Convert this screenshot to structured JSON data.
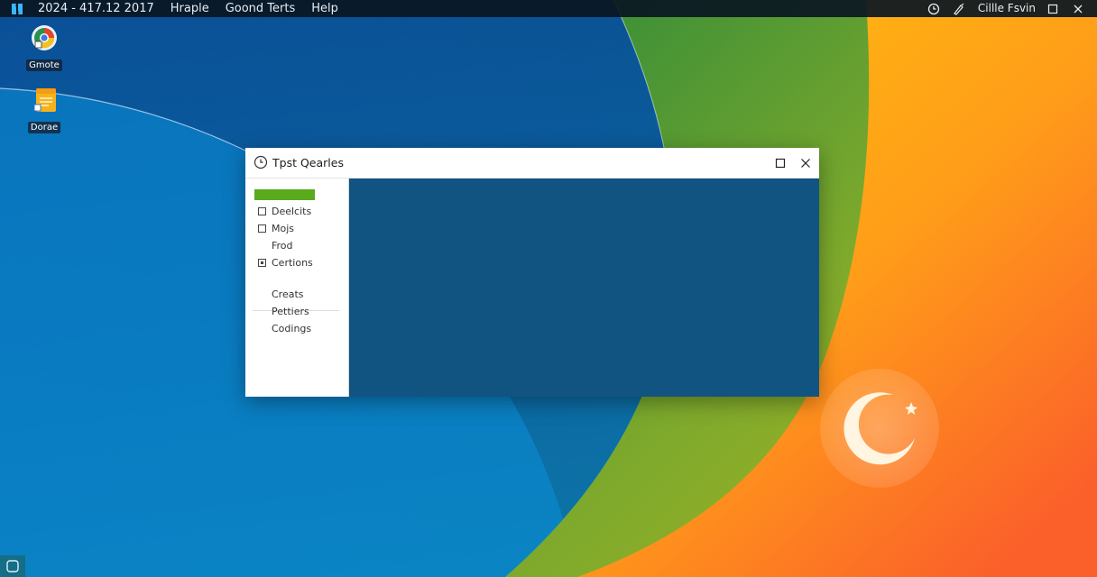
{
  "menubar": {
    "datetime": "2024 - 417.12 2017",
    "menus": [
      "Hraple",
      "Goond Terts",
      "Help"
    ],
    "user": "Cillle Fsvin"
  },
  "desktop_icons": [
    {
      "label": "Gmote",
      "icon": "browser-icon"
    },
    {
      "label": "Dorae",
      "icon": "notes-icon"
    }
  ],
  "window": {
    "title": "Tpst Qearles",
    "sidebar_group1": [
      {
        "label": "Deelcits",
        "check": "box"
      },
      {
        "label": "Mojs",
        "check": "box"
      },
      {
        "label": "Frod",
        "check": "none"
      },
      {
        "label": "Certions",
        "check": "dot"
      }
    ],
    "sidebar_group2": [
      {
        "label": "Creats"
      },
      {
        "label": "Pettiers"
      },
      {
        "label": "Codings"
      }
    ]
  },
  "colors": {
    "accent_green": "#5aaa1e",
    "content_blue": "#115481",
    "menubar_bg": "#0a1622"
  }
}
